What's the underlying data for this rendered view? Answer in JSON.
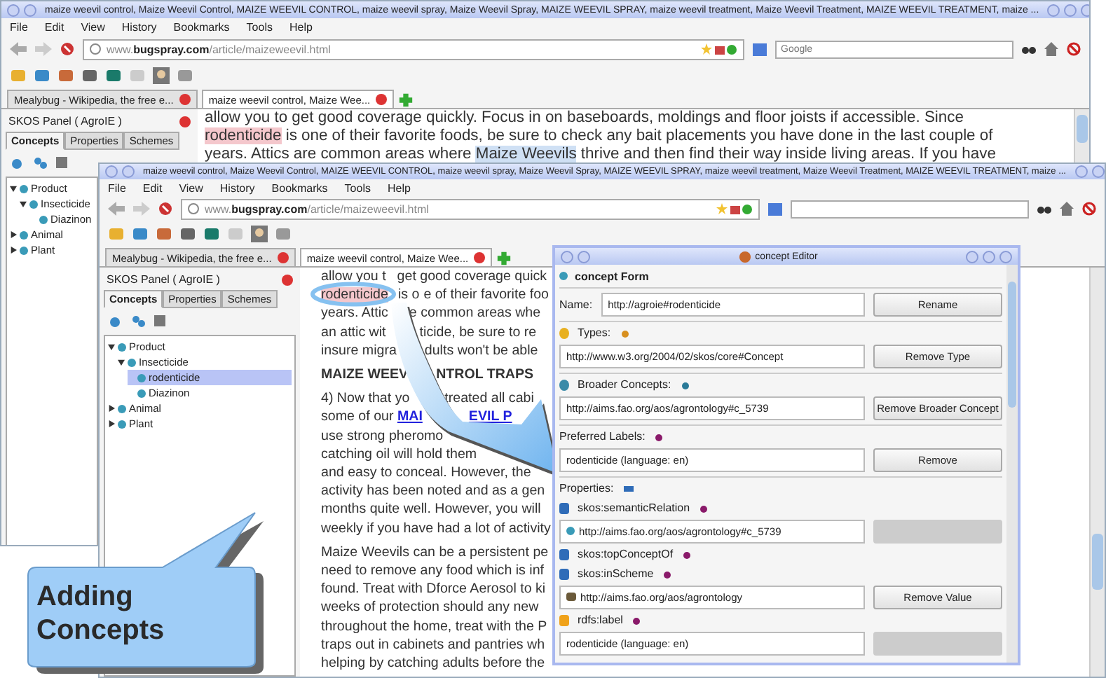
{
  "back_window": {
    "title": "maize weevil control, Maize Weevil Control, MAIZE WEEVIL CONTROL, maize weevil spray, Maize Weevil Spray, MAIZE WEEVIL SPRAY, maize weevil treatment, Maize Weevil Treatment, MAIZE WEEVIL TREATMENT, maize ...",
    "menu": [
      "File",
      "Edit",
      "View",
      "History",
      "Bookmarks",
      "Tools",
      "Help"
    ],
    "url": "www.**bugspray.com**/article/maizeweevil.html",
    "search": {
      "placeholder": "Google"
    },
    "tabs": [
      {
        "label": "Mealybug - Wikipedia, the free e...",
        "selected": false
      },
      {
        "label": "maize weevil control, Maize Wee...",
        "selected": true
      }
    ],
    "panel": {
      "title": "SKOS Panel ( AgroIE )",
      "tabs": [
        {
          "label": "Concepts",
          "selected": true
        },
        {
          "label": "Properties",
          "selected": false
        },
        {
          "label": "Schemes",
          "selected": false
        }
      ],
      "tree": [
        {
          "label": "Product",
          "expanded": true,
          "selected": false,
          "children": [
            {
              "label": "Insecticide",
              "expanded": true,
              "selected": false,
              "children": [
                {
                  "label": "Diazinon",
                  "selected": false
                }
              ]
            }
          ]
        },
        {
          "label": "Animal",
          "expanded": false,
          "selected": false
        },
        {
          "label": "Plant",
          "expanded": false,
          "selected": false
        }
      ]
    },
    "paragraphs": [
      {
        "kind": "text",
        "lines": [
          [
            [
              {
                "text": "allow you to get good coverage quickly. Focus in on baseboards, moldings and floor joists if accessible. Since"
              }
            ]
          ],
          [
            [
              {
                "text": "rodenticide",
                "kind": "highlight"
              },
              {
                "text": " is one of their favorite foods, be sure to check any bait placements you have done in the last couple of"
              }
            ]
          ],
          [
            [
              {
                "text": "years. Attics are common areas where "
              },
              {
                "text": "Maize Weevils",
                "kind": "selection"
              },
              {
                "text": " thrive and then find their way inside living areas. If you have"
              }
            ]
          ]
        ]
      }
    ]
  },
  "front_window": {
    "title": "maize weevil control, Maize Weevil Control, MAIZE WEEVIL CONTROL, maize weevil spray, Maize Weevil Spray, MAIZE WEEVIL SPRAY, maize weevil treatment, Maize Weevil Treatment, MAIZE WEEVIL TREATMENT, maize ...",
    "menu": [
      "File",
      "Edit",
      "View",
      "History",
      "Bookmarks",
      "Tools",
      "Help"
    ],
    "url": "www.**bugspray.com**/article/maizeweevil.html",
    "tabs": [
      {
        "label": "Mealybug - Wikipedia, the free e...",
        "selected": false
      },
      {
        "label": "maize weevil control, Maize Wee...",
        "selected": true
      }
    ],
    "panel": {
      "title": "SKOS Panel ( AgroIE )",
      "tabs": [
        {
          "label": "Concepts",
          "selected": true
        },
        {
          "label": "Properties",
          "selected": false
        },
        {
          "label": "Schemes",
          "selected": false
        }
      ],
      "tree": [
        {
          "label": "Product",
          "expanded": true,
          "selected": false,
          "children": [
            {
              "label": "Insecticide",
              "expanded": true,
              "selected": false,
              "children": [
                {
                  "label": "rodenticide",
                  "selected": true
                },
                {
                  "label": "Diazinon",
                  "selected": false
                }
              ]
            }
          ]
        },
        {
          "label": "Animal",
          "expanded": false,
          "selected": false
        },
        {
          "label": "Plant",
          "expanded": false,
          "selected": false
        }
      ]
    },
    "paragraphs": [
      {
        "kind": "text",
        "lines": [
          [
            [
              {
                "text": "allow you t"
              }
            ],
            [
              {
                "text": "get good coverage quick"
              }
            ]
          ],
          [
            [
              {
                "text": "rodenticide",
                "kind": "highlight"
              }
            ],
            [
              {
                "text": "is o"
              }
            ],
            [
              {
                "text": "e of their favorite foo"
              }
            ]
          ],
          [
            [
              {
                "text": "years. Attic"
              }
            ],
            [
              {
                "text": "e common areas whe"
              }
            ]
          ],
          [
            [
              {
                "text": "an attic wit"
              }
            ],
            [
              {
                "text": "ticide, be sure to re"
              }
            ]
          ],
          [
            [
              {
                "text": "insure migra"
              }
            ],
            [
              {
                "text": "dults won't be able"
              }
            ]
          ]
        ]
      },
      {
        "kind": "heading",
        "lines": [
          [
            [
              {
                "text": "MAIZE WEEV"
              }
            ],
            [
              {
                "text": "NTROL TRAPS"
              }
            ]
          ]
        ]
      },
      {
        "kind": "text",
        "lines": [
          [
            [
              {
                "text": "4) Now that yo"
              }
            ],
            [
              {
                "text": "treated all cabi"
              }
            ]
          ],
          [
            [
              {
                "text": "some of our "
              },
              {
                "text": "MAI",
                "kind": "link"
              }
            ],
            [
              {
                "text": "EVIL P",
                "kind": "link"
              }
            ]
          ],
          [
            [
              {
                "text": "use strong pheromo"
              }
            ]
          ],
          [
            [
              {
                "text": "catching oil will hold them"
              }
            ]
          ],
          [
            [
              {
                "text": "and easy to conceal. However, the"
              }
            ]
          ],
          [
            [
              {
                "text": "activity has been noted and as a gen"
              }
            ]
          ],
          [
            [
              {
                "text": "months quite well. However, you will"
              }
            ]
          ],
          [
            [
              {
                "text": "weekly if you have had a lot of activity"
              }
            ]
          ]
        ]
      },
      {
        "kind": "text",
        "lines": [
          [
            [
              {
                "text": "Maize Weevils can be a persistent pe"
              }
            ]
          ],
          [
            [
              {
                "text": "need to remove any food which is inf"
              }
            ]
          ],
          [
            [
              {
                "text": "found. Treat with Dforce Aerosol to ki"
              }
            ]
          ],
          [
            [
              {
                "text": "weeks of protection should any new"
              }
            ]
          ],
          [
            [
              {
                "text": "throughout the home, treat with the P"
              }
            ]
          ],
          [
            [
              {
                "text": "traps out in cabinets and pantries wh"
              }
            ]
          ],
          [
            [
              {
                "text": "helping by catching adults before the"
              }
            ]
          ]
        ]
      }
    ]
  },
  "dialog": {
    "title": "concept Editor",
    "header": "concept Form",
    "name": {
      "label": "Name:",
      "value": "http://agroie#rodenticide",
      "button": "Rename"
    },
    "sections": [
      {
        "kind": "types",
        "label": "Types:",
        "value": "http://www.w3.org/2004/02/skos/core#Concept",
        "button": "Remove Type"
      },
      {
        "kind": "broader",
        "label": "Broader Concepts:",
        "value": "http://aims.fao.org/aos/agrontology#c_5739",
        "button": "Remove Broader Concept"
      },
      {
        "kind": "labels",
        "label": "Preferred Labels:",
        "value": "rodenticide (language: en)",
        "button": "Remove"
      }
    ],
    "properties": {
      "label": "Properties:",
      "items": [
        {
          "kind": "object",
          "name": "skos:semanticRelation",
          "value": {
            "kind": "concept",
            "text": "http://aims.fao.org/aos/agrontology#c_5739"
          },
          "button": {
            "disabled": true
          }
        },
        {
          "kind": "object",
          "name": "skos:topConceptOf"
        },
        {
          "kind": "object",
          "name": "skos:inScheme",
          "value": {
            "kind": "scheme",
            "text": "http://aims.fao.org/aos/agrontology"
          },
          "button": {
            "label": "Remove Value",
            "disabled": false
          }
        },
        {
          "kind": "annotation",
          "name": "rdfs:label",
          "value": {
            "kind": "literal",
            "text": "rodenticide (language: en)"
          },
          "button": {
            "disabled": true
          }
        }
      ]
    }
  },
  "callout": {
    "text": "Adding Concepts"
  }
}
